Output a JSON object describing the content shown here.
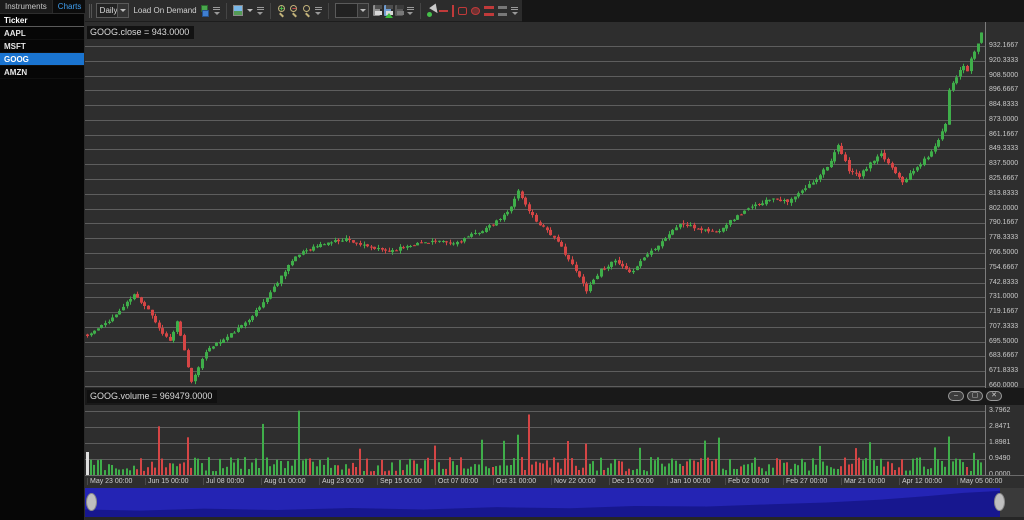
{
  "app": {
    "background": "#1c1c1c"
  },
  "sidebar": {
    "tabs": [
      {
        "label": "Instruments",
        "active": false
      },
      {
        "label": "Charts",
        "active": true,
        "close_glyph": "✕"
      }
    ],
    "list_header": "Ticker",
    "items": [
      {
        "label": "AAPL",
        "selected": false
      },
      {
        "label": "MSFT",
        "selected": false
      },
      {
        "label": "GOOG",
        "selected": true
      },
      {
        "label": "AMZN",
        "selected": false
      }
    ]
  },
  "toolbar": {
    "interval_value": "Daily",
    "load_on_demand_label": "Load On Demand",
    "template_value": "",
    "icons": {
      "load_on_demand": "data-cubes-icon",
      "chart_type": "picture-icon",
      "zoom_in_glyph": "+",
      "zoom_out_glyph": "−",
      "save": "floppy-icon",
      "save_update": "floppy-green-arrow-icon",
      "save_disabled": "floppy-dim-icon",
      "pointer": "pointer-green-dot-icon",
      "drawing_tools": [
        "red-horizontal-line",
        "red-vertical-line",
        "red-rectangle",
        "red-ellipse",
        "red-parallel-lines",
        "gray-parallel-lines"
      ]
    }
  },
  "price_panel": {
    "series_label": "GOOG.close = 943.0000",
    "axis_labels": [
      "932.1667",
      "920.3333",
      "908.5000",
      "896.6667",
      "884.8333",
      "873.0000",
      "861.1667",
      "849.3333",
      "837.5000",
      "825.6667",
      "813.8333",
      "802.0000",
      "790.1667",
      "778.3333",
      "766.5000",
      "754.6667",
      "742.8333",
      "731.0000",
      "719.1667",
      "707.3333",
      "695.5000",
      "683.6667",
      "671.8333",
      "660.0000"
    ]
  },
  "volume_panel": {
    "series_label": "GOOG.volume = 969479.0000",
    "axis_labels": [
      "3.7962",
      "2.8471",
      "1.8981",
      "0.9490",
      "0.0000"
    ],
    "window_buttons": [
      {
        "name": "minimize-button",
        "glyph": "–"
      },
      {
        "name": "maximize-button",
        "glyph": "▢"
      },
      {
        "name": "close-button",
        "glyph": "✕"
      }
    ]
  },
  "time_axis": {
    "labels": [
      "May 23 00:00",
      "Jun 15 00:00",
      "Jul 08 00:00",
      "Aug 01 00:00",
      "Aug 23 00:00",
      "Sep 15 00:00",
      "Oct 07 00:00",
      "Oct 31 00:00",
      "Nov 22 00:00",
      "Dec 15 00:00",
      "Jan 10 00:00",
      "Feb 02 00:00",
      "Feb 27 00:00",
      "Mar 21 00:00",
      "Apr 12 00:00",
      "May 05 00:00"
    ]
  },
  "scrollbar": {
    "track_color": "#3a3a3a",
    "thumb_color": "#2424b4",
    "wave_color": "#17178f"
  },
  "chart_data": {
    "type": "candlestick",
    "symbol": "GOOG",
    "interval": "Daily",
    "last_close": 943.0,
    "last_volume": 969479.0,
    "price_axis": {
      "min": 660.0,
      "max": 932.1667,
      "step": 11.8333
    },
    "volume_axis": {
      "min": 0.0,
      "max": 3.7962,
      "step": 0.94905,
      "unit": "millions"
    },
    "candle_count": 250,
    "up_color": "#3fae4a",
    "down_color": "#d54545",
    "grid_color": "#5e5e5e",
    "close_anchors": [
      [
        0,
        700
      ],
      [
        4,
        708
      ],
      [
        8,
        717
      ],
      [
        13,
        733
      ],
      [
        17,
        722
      ],
      [
        20,
        706
      ],
      [
        23,
        696
      ],
      [
        25,
        711
      ],
      [
        27,
        688
      ],
      [
        29,
        663
      ],
      [
        31,
        676
      ],
      [
        34,
        691
      ],
      [
        38,
        697
      ],
      [
        43,
        708
      ],
      [
        48,
        723
      ],
      [
        52,
        739
      ],
      [
        56,
        757
      ],
      [
        60,
        768
      ],
      [
        66,
        774
      ],
      [
        72,
        778
      ],
      [
        78,
        771
      ],
      [
        84,
        768
      ],
      [
        90,
        773
      ],
      [
        96,
        776
      ],
      [
        102,
        774
      ],
      [
        108,
        782
      ],
      [
        113,
        789
      ],
      [
        117,
        799
      ],
      [
        120,
        816
      ],
      [
        122,
        805
      ],
      [
        125,
        792
      ],
      [
        128,
        785
      ],
      [
        132,
        771
      ],
      [
        136,
        752
      ],
      [
        139,
        737
      ],
      [
        143,
        753
      ],
      [
        147,
        760
      ],
      [
        151,
        750
      ],
      [
        155,
        763
      ],
      [
        160,
        776
      ],
      [
        165,
        790
      ],
      [
        170,
        786
      ],
      [
        175,
        783
      ],
      [
        179,
        792
      ],
      [
        183,
        800
      ],
      [
        187,
        806
      ],
      [
        191,
        811
      ],
      [
        195,
        807
      ],
      [
        199,
        816
      ],
      [
        203,
        826
      ],
      [
        207,
        840
      ],
      [
        209,
        852
      ],
      [
        212,
        833
      ],
      [
        215,
        828
      ],
      [
        218,
        838
      ],
      [
        221,
        845
      ],
      [
        224,
        835
      ],
      [
        227,
        824
      ],
      [
        230,
        832
      ],
      [
        233,
        841
      ],
      [
        235,
        847
      ],
      [
        237,
        858
      ],
      [
        239,
        870
      ],
      [
        240,
        898
      ],
      [
        242,
        908
      ],
      [
        244,
        916
      ],
      [
        245,
        912
      ],
      [
        246,
        921
      ],
      [
        247,
        928
      ],
      [
        248,
        934
      ],
      [
        249,
        943
      ]
    ],
    "volume_spikes_millions": {
      "20": 2.85,
      "28": 2.1,
      "49": 2.9,
      "59": 3.79,
      "76": 1.45,
      "97": 1.6,
      "110": 2.0,
      "116": 2.0,
      "120": 2.35,
      "123": 3.5,
      "134": 1.95,
      "139": 1.8,
      "154": 1.5,
      "172": 1.9,
      "176": 2.2,
      "204": 1.7,
      "214": 1.5,
      "218": 1.9,
      "236": 1.5,
      "240": 2.2,
      "247": 1.3
    },
    "render_seed": 11
  }
}
